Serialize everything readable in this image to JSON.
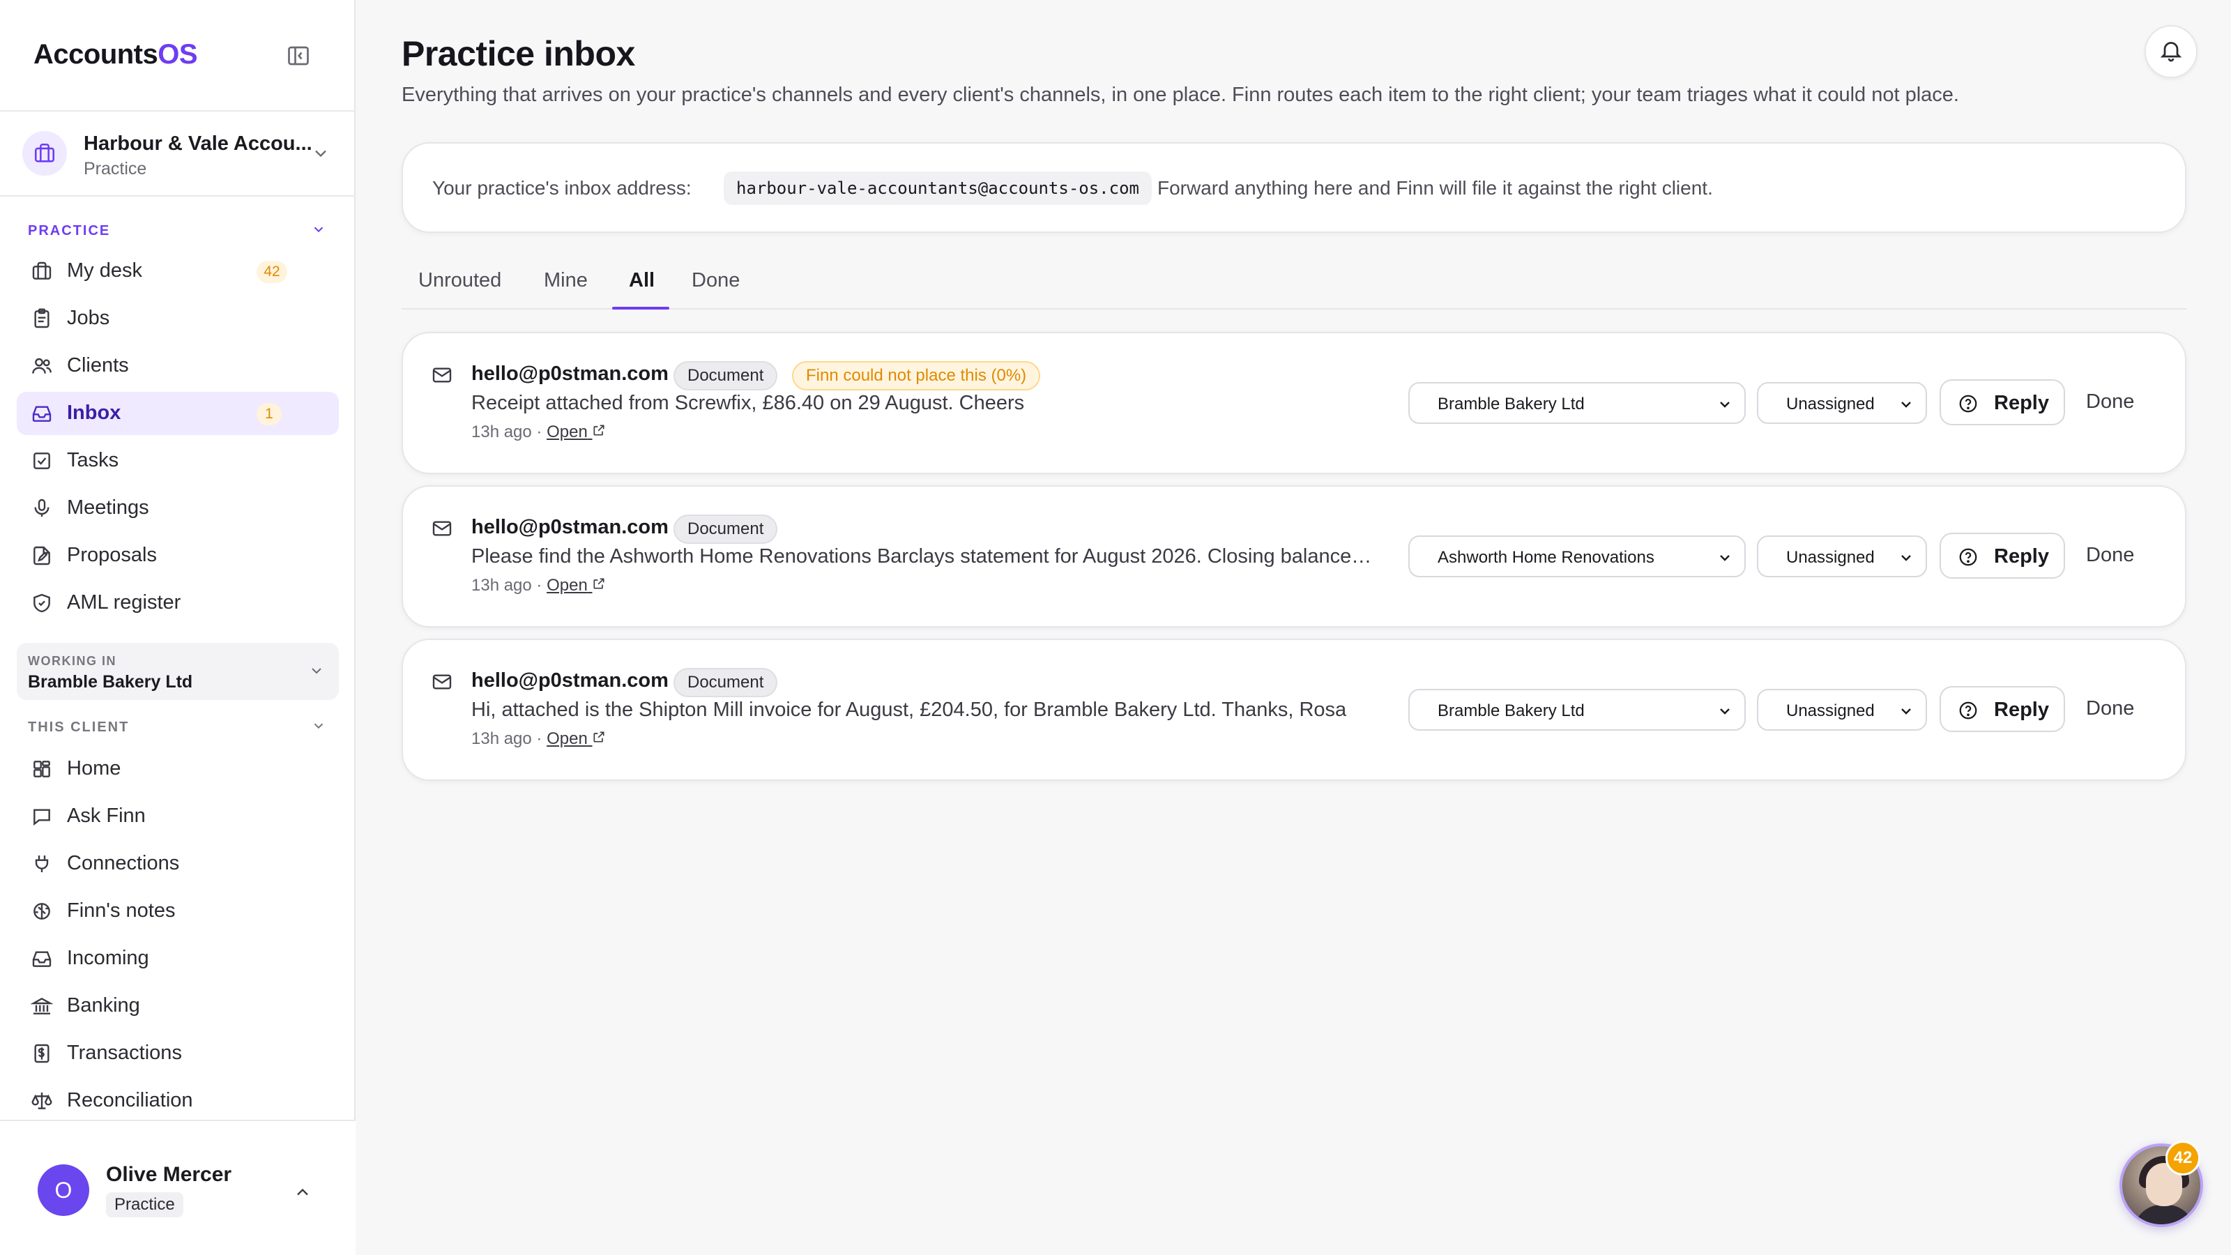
{
  "app": {
    "brand_main": "Accounts",
    "brand_accent": "OS",
    "accent_color": "#6d3df2"
  },
  "org": {
    "name": "Harbour & Vale Accou...",
    "type": "Practice"
  },
  "sidebar": {
    "practice_section": "PRACTICE",
    "practice_items": [
      {
        "label": "My desk",
        "icon": "briefcase-icon",
        "badge": "42"
      },
      {
        "label": "Jobs",
        "icon": "clipboard-icon"
      },
      {
        "label": "Clients",
        "icon": "users-icon"
      },
      {
        "label": "Inbox",
        "icon": "inbox-icon",
        "badge": "1",
        "active": true
      },
      {
        "label": "Tasks",
        "icon": "checkbox-icon"
      },
      {
        "label": "Meetings",
        "icon": "microphone-icon"
      },
      {
        "label": "Proposals",
        "icon": "document-edit-icon"
      },
      {
        "label": "AML register",
        "icon": "shield-icon"
      }
    ],
    "working_in_label": "WORKING IN",
    "working_in_value": "Bramble Bakery Ltd",
    "client_section": "THIS CLIENT",
    "client_items": [
      {
        "label": "Home",
        "icon": "grid-icon"
      },
      {
        "label": "Ask Finn",
        "icon": "chat-icon"
      },
      {
        "label": "Connections",
        "icon": "plug-icon"
      },
      {
        "label": "Finn's notes",
        "icon": "brain-icon"
      },
      {
        "label": "Incoming",
        "icon": "tray-icon"
      },
      {
        "label": "Banking",
        "icon": "bank-icon"
      },
      {
        "label": "Transactions",
        "icon": "receipt-icon"
      },
      {
        "label": "Reconciliation",
        "icon": "scale-icon"
      }
    ]
  },
  "user": {
    "initial": "O",
    "name": "Olive Mercer",
    "role": "Practice"
  },
  "page": {
    "title": "Practice inbox",
    "description": "Everything that arrives on your practice's channels and every client's channels, in one place. Finn routes each item to the right client; your team triages what it could not place."
  },
  "address_card": {
    "label": "Your practice's inbox address:",
    "address": "harbour-vale-accountants@accounts-os.com",
    "hint": "Forward anything here and Finn will file it against the right client."
  },
  "tabs": [
    {
      "label": "Unrouted"
    },
    {
      "label": "Mine"
    },
    {
      "label": "All",
      "active": true
    },
    {
      "label": "Done"
    }
  ],
  "items": [
    {
      "sender": "hello@p0stman.com",
      "type_badge": "Document",
      "warning_badge": "Finn could not place this (0%)",
      "snippet": "Receipt attached from Screwfix, £86.40 on 29 August. Cheers",
      "time": "13h ago · ",
      "open_label": "Open",
      "client": "Bramble Bakery Ltd",
      "assignee": "Unassigned",
      "reply_label": "Reply",
      "done_label": "Done"
    },
    {
      "sender": "hello@p0stman.com",
      "type_badge": "Document",
      "snippet": "Please find the Ashworth Home Renovations Barclays statement for August 2026. Closing balance…",
      "time": "13h ago · ",
      "open_label": "Open",
      "client": "Ashworth Home Renovations",
      "assignee": "Unassigned",
      "reply_label": "Reply",
      "done_label": "Done"
    },
    {
      "sender": "hello@p0stman.com",
      "type_badge": "Document",
      "snippet": "Hi, attached is the Shipton Mill invoice for August, £204.50, for Bramble Bakery Ltd. Thanks, Rosa",
      "time": "13h ago · ",
      "open_label": "Open",
      "client": "Bramble Bakery Ltd",
      "assignee": "Unassigned",
      "reply_label": "Reply",
      "done_label": "Done"
    }
  ],
  "finn_assistant": {
    "badge": "42"
  }
}
